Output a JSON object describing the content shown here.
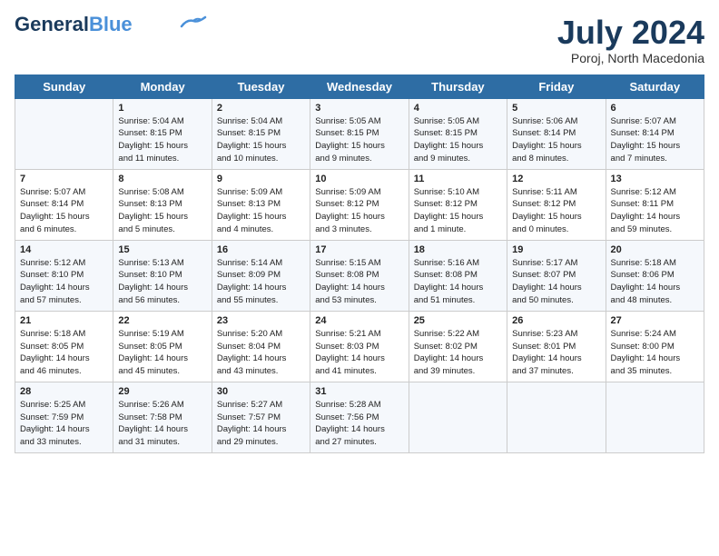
{
  "header": {
    "logo_line1": "General",
    "logo_line2": "Blue",
    "month_year": "July 2024",
    "location": "Poroj, North Macedonia"
  },
  "weekdays": [
    "Sunday",
    "Monday",
    "Tuesday",
    "Wednesday",
    "Thursday",
    "Friday",
    "Saturday"
  ],
  "weeks": [
    [
      {
        "day": "",
        "info": ""
      },
      {
        "day": "1",
        "info": "Sunrise: 5:04 AM\nSunset: 8:15 PM\nDaylight: 15 hours\nand 11 minutes."
      },
      {
        "day": "2",
        "info": "Sunrise: 5:04 AM\nSunset: 8:15 PM\nDaylight: 15 hours\nand 10 minutes."
      },
      {
        "day": "3",
        "info": "Sunrise: 5:05 AM\nSunset: 8:15 PM\nDaylight: 15 hours\nand 9 minutes."
      },
      {
        "day": "4",
        "info": "Sunrise: 5:05 AM\nSunset: 8:15 PM\nDaylight: 15 hours\nand 9 minutes."
      },
      {
        "day": "5",
        "info": "Sunrise: 5:06 AM\nSunset: 8:14 PM\nDaylight: 15 hours\nand 8 minutes."
      },
      {
        "day": "6",
        "info": "Sunrise: 5:07 AM\nSunset: 8:14 PM\nDaylight: 15 hours\nand 7 minutes."
      }
    ],
    [
      {
        "day": "7",
        "info": "Sunrise: 5:07 AM\nSunset: 8:14 PM\nDaylight: 15 hours\nand 6 minutes."
      },
      {
        "day": "8",
        "info": "Sunrise: 5:08 AM\nSunset: 8:13 PM\nDaylight: 15 hours\nand 5 minutes."
      },
      {
        "day": "9",
        "info": "Sunrise: 5:09 AM\nSunset: 8:13 PM\nDaylight: 15 hours\nand 4 minutes."
      },
      {
        "day": "10",
        "info": "Sunrise: 5:09 AM\nSunset: 8:12 PM\nDaylight: 15 hours\nand 3 minutes."
      },
      {
        "day": "11",
        "info": "Sunrise: 5:10 AM\nSunset: 8:12 PM\nDaylight: 15 hours\nand 1 minute."
      },
      {
        "day": "12",
        "info": "Sunrise: 5:11 AM\nSunset: 8:12 PM\nDaylight: 15 hours\nand 0 minutes."
      },
      {
        "day": "13",
        "info": "Sunrise: 5:12 AM\nSunset: 8:11 PM\nDaylight: 14 hours\nand 59 minutes."
      }
    ],
    [
      {
        "day": "14",
        "info": "Sunrise: 5:12 AM\nSunset: 8:10 PM\nDaylight: 14 hours\nand 57 minutes."
      },
      {
        "day": "15",
        "info": "Sunrise: 5:13 AM\nSunset: 8:10 PM\nDaylight: 14 hours\nand 56 minutes."
      },
      {
        "day": "16",
        "info": "Sunrise: 5:14 AM\nSunset: 8:09 PM\nDaylight: 14 hours\nand 55 minutes."
      },
      {
        "day": "17",
        "info": "Sunrise: 5:15 AM\nSunset: 8:08 PM\nDaylight: 14 hours\nand 53 minutes."
      },
      {
        "day": "18",
        "info": "Sunrise: 5:16 AM\nSunset: 8:08 PM\nDaylight: 14 hours\nand 51 minutes."
      },
      {
        "day": "19",
        "info": "Sunrise: 5:17 AM\nSunset: 8:07 PM\nDaylight: 14 hours\nand 50 minutes."
      },
      {
        "day": "20",
        "info": "Sunrise: 5:18 AM\nSunset: 8:06 PM\nDaylight: 14 hours\nand 48 minutes."
      }
    ],
    [
      {
        "day": "21",
        "info": "Sunrise: 5:18 AM\nSunset: 8:05 PM\nDaylight: 14 hours\nand 46 minutes."
      },
      {
        "day": "22",
        "info": "Sunrise: 5:19 AM\nSunset: 8:05 PM\nDaylight: 14 hours\nand 45 minutes."
      },
      {
        "day": "23",
        "info": "Sunrise: 5:20 AM\nSunset: 8:04 PM\nDaylight: 14 hours\nand 43 minutes."
      },
      {
        "day": "24",
        "info": "Sunrise: 5:21 AM\nSunset: 8:03 PM\nDaylight: 14 hours\nand 41 minutes."
      },
      {
        "day": "25",
        "info": "Sunrise: 5:22 AM\nSunset: 8:02 PM\nDaylight: 14 hours\nand 39 minutes."
      },
      {
        "day": "26",
        "info": "Sunrise: 5:23 AM\nSunset: 8:01 PM\nDaylight: 14 hours\nand 37 minutes."
      },
      {
        "day": "27",
        "info": "Sunrise: 5:24 AM\nSunset: 8:00 PM\nDaylight: 14 hours\nand 35 minutes."
      }
    ],
    [
      {
        "day": "28",
        "info": "Sunrise: 5:25 AM\nSunset: 7:59 PM\nDaylight: 14 hours\nand 33 minutes."
      },
      {
        "day": "29",
        "info": "Sunrise: 5:26 AM\nSunset: 7:58 PM\nDaylight: 14 hours\nand 31 minutes."
      },
      {
        "day": "30",
        "info": "Sunrise: 5:27 AM\nSunset: 7:57 PM\nDaylight: 14 hours\nand 29 minutes."
      },
      {
        "day": "31",
        "info": "Sunrise: 5:28 AM\nSunset: 7:56 PM\nDaylight: 14 hours\nand 27 minutes."
      },
      {
        "day": "",
        "info": ""
      },
      {
        "day": "",
        "info": ""
      },
      {
        "day": "",
        "info": ""
      }
    ]
  ]
}
